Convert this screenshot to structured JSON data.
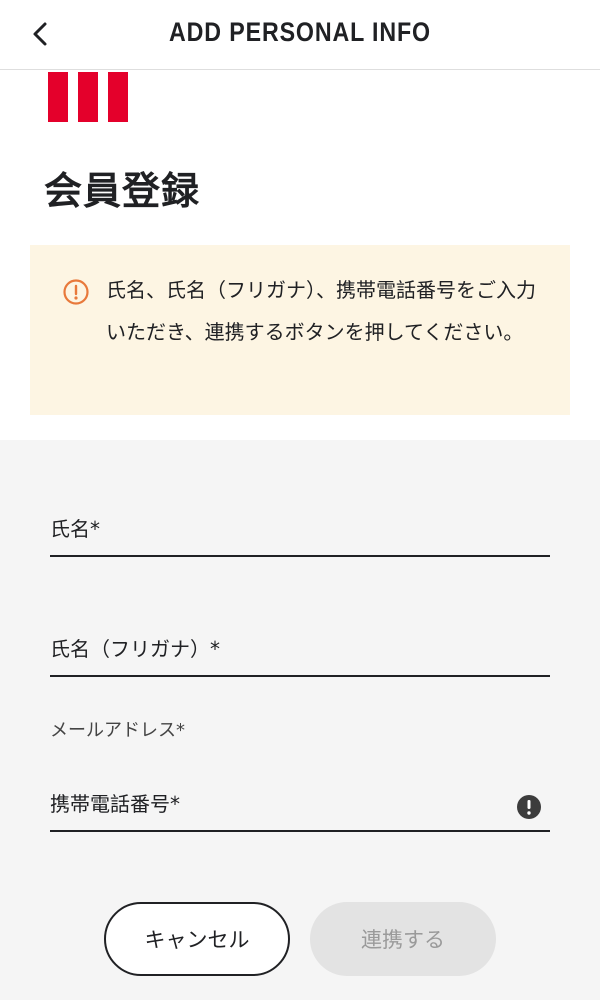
{
  "header": {
    "title": "ADD PERSONAL INFO",
    "back_icon": "chevron-left-icon"
  },
  "brand": {
    "stripe_color": "#e4002b"
  },
  "page": {
    "title": "会員登録"
  },
  "notice": {
    "icon": "info-circle-icon",
    "text": "氏名、氏名（フリガナ）、携帯電話番号をご入力いただき、連携するボタンを押してください。",
    "background": "#fdf5e3",
    "icon_color": "#e8793b"
  },
  "form": {
    "name_label": "氏名*",
    "name_kana_label": "氏名（フリガナ）*",
    "email_label": "メールアドレス*",
    "phone_label": "携帯電話番号*",
    "phone_alert_icon": "exclamation-circle-icon"
  },
  "actions": {
    "cancel_label": "キャンセル",
    "link_label": "連携する"
  }
}
